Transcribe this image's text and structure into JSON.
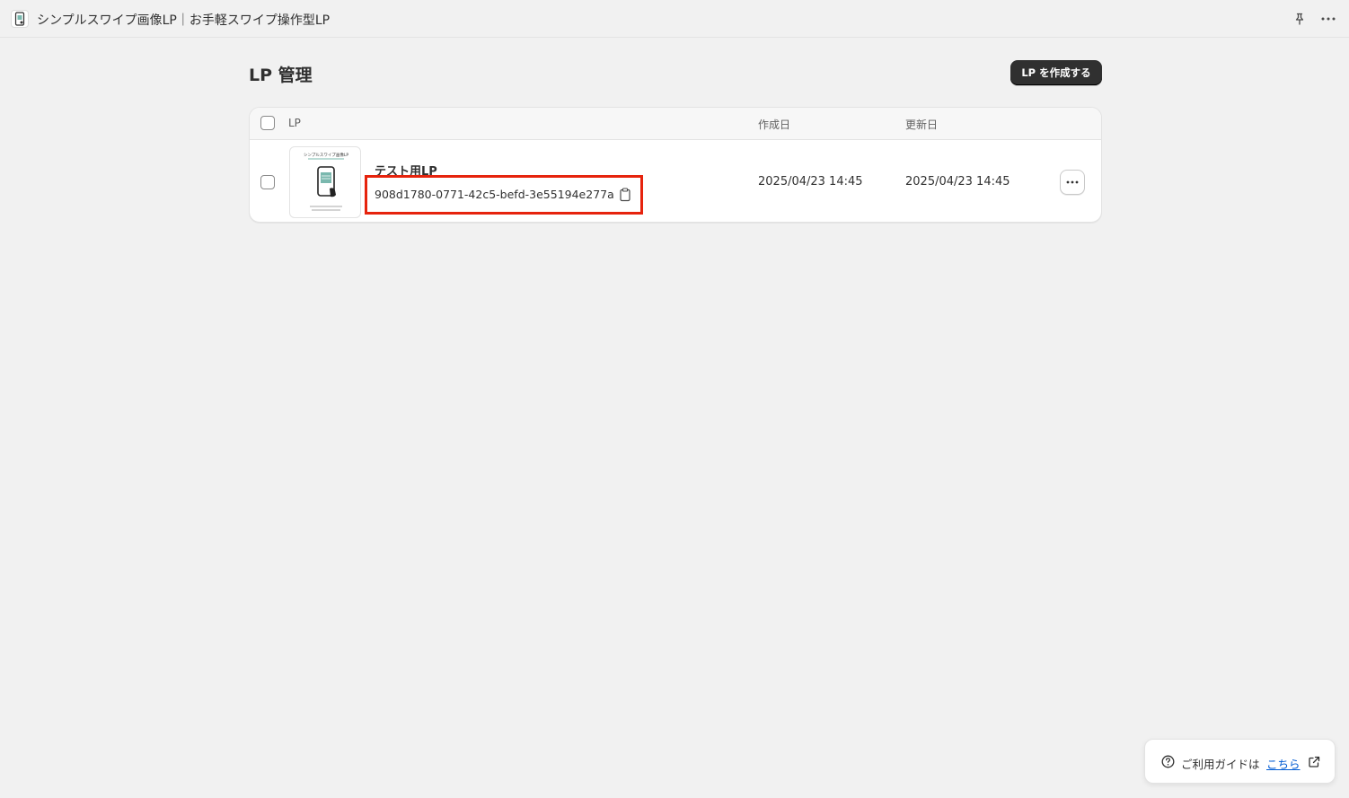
{
  "topbar": {
    "app_title": "シンプルスワイプ画像LP｜お手軽スワイプ操作型LP",
    "icons": [
      "app-logo-icon",
      "pin-icon",
      "more-horizontal-icon"
    ]
  },
  "page": {
    "title": "LP 管理",
    "create_button": "LP を作成する"
  },
  "table": {
    "headers": {
      "lp": "LP",
      "created": "作成日",
      "updated": "更新日"
    },
    "rows": [
      {
        "name": "テスト用LP",
        "id": "908d1780-0771-42c5-befd-3e55194e277a",
        "created": "2025/04/23 14:45",
        "updated": "2025/04/23 14:45",
        "thumbnail_title": "シンプルスワイプ画像LP"
      }
    ]
  },
  "guide": {
    "text": "ご利用ガイドは",
    "link": "こちら"
  },
  "colors": {
    "highlight_border": "#e6230d",
    "primary_button": "#303030",
    "link": "#005bd3",
    "background": "#f1f1f1"
  }
}
